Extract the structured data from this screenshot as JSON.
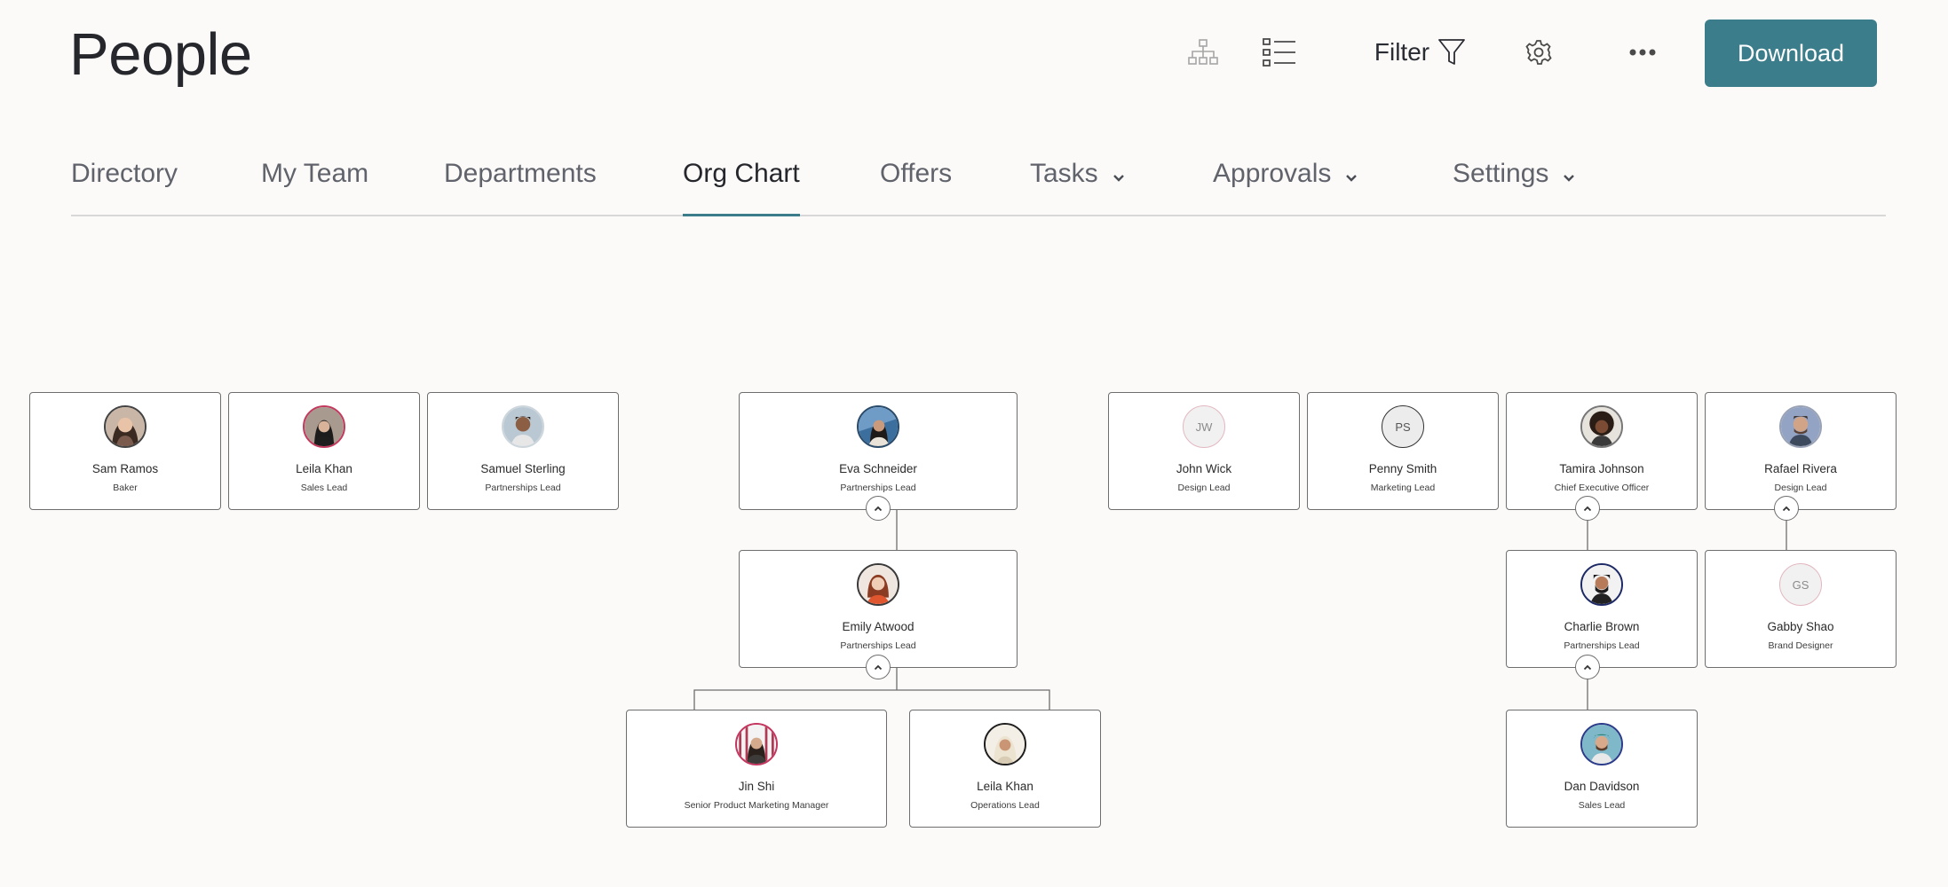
{
  "header": {
    "title": "People",
    "filter_label": "Filter",
    "download_label": "Download",
    "icons": [
      "org-chart-view-icon",
      "list-view-icon",
      "filter-icon",
      "gear-icon",
      "more-icon"
    ]
  },
  "tabs": [
    {
      "label": "Directory",
      "active": false
    },
    {
      "label": "My Team",
      "active": false
    },
    {
      "label": "Departments",
      "active": false
    },
    {
      "label": "Org Chart",
      "active": true
    },
    {
      "label": "Offers",
      "active": false
    },
    {
      "label": "Tasks",
      "active": false,
      "dropdown": true
    },
    {
      "label": "Approvals",
      "active": false,
      "dropdown": true
    },
    {
      "label": "Settings",
      "active": false,
      "dropdown": true
    }
  ],
  "org_chart": {
    "people": [
      {
        "name": "Sam Ramos",
        "role": "Baker"
      },
      {
        "name": "Leila Khan",
        "role": "Sales Lead"
      },
      {
        "name": "Samuel Sterling",
        "role": "Partnerships Lead"
      },
      {
        "name": "Eva Schneider",
        "role": "Partnerships Lead"
      },
      {
        "name": "Emily Atwood",
        "role": "Partnerships Lead"
      },
      {
        "name": "Jin Shi",
        "role": "Senior Product Marketing Manager"
      },
      {
        "name": "Leila Khan",
        "role": "Operations Lead"
      },
      {
        "name": "John Wick",
        "role": "Design Lead",
        "initials": "JW"
      },
      {
        "name": "Penny Smith",
        "role": "Marketing Lead",
        "initials": "PS"
      },
      {
        "name": "Tamira Johnson",
        "role": "Chief Executive Officer"
      },
      {
        "name": "Rafael Rivera",
        "role": "Design Lead"
      },
      {
        "name": "Charlie Brown",
        "role": "Partnerships Lead"
      },
      {
        "name": "Gabby Shao",
        "role": "Brand Designer",
        "initials": "GS"
      },
      {
        "name": "Dan Davidson",
        "role": "Sales Lead"
      }
    ]
  },
  "colors": {
    "accent": "#3b7d8a",
    "background": "#fbfaf8",
    "card_border": "#6e6e6e"
  }
}
